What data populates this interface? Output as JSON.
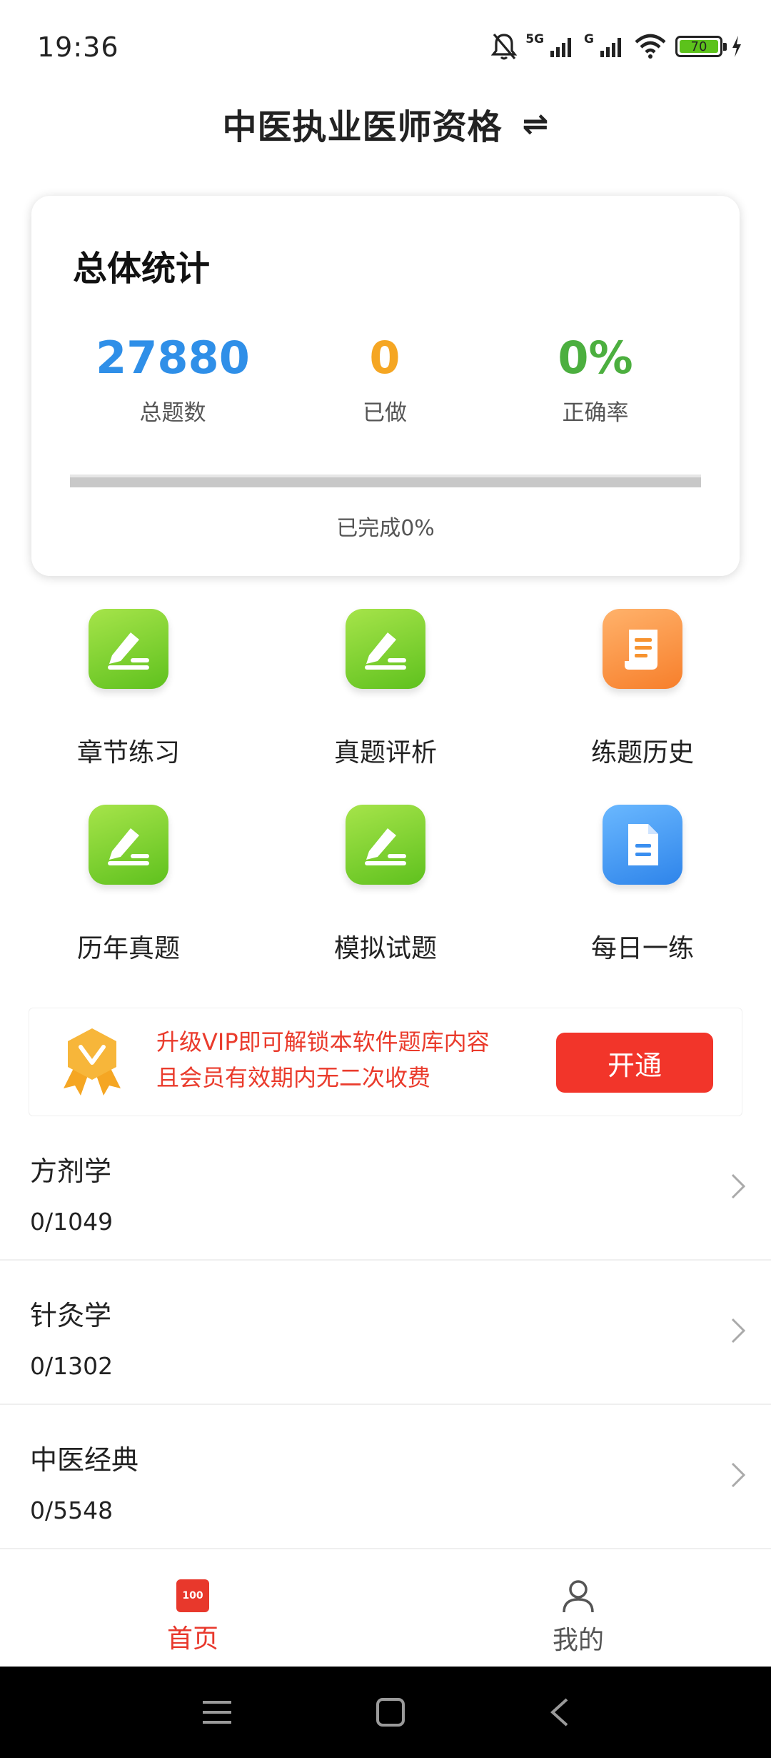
{
  "status_bar": {
    "time": "19:36",
    "network_1": "5G",
    "network_2": "G",
    "battery": "70",
    "icons": [
      "mute-bell-icon",
      "signal-icon",
      "signal-icon",
      "wifi-icon",
      "battery-icon",
      "charging-icon"
    ]
  },
  "header": {
    "title": "中医执业医师资格",
    "switch_icon": "⇌"
  },
  "stats": {
    "heading": "总体统计",
    "total": {
      "value": "27880",
      "label": "总题数",
      "color": "#2f8fe8"
    },
    "done": {
      "value": "0",
      "label": "已做",
      "color": "#f5a623"
    },
    "accuracy": {
      "value": "0%",
      "label": "正确率",
      "color": "#4caf3f"
    },
    "progress_fraction": 0,
    "progress_text": "已完成0%"
  },
  "features": [
    {
      "label": "章节练习",
      "icon": "pencil-icon",
      "color": "green"
    },
    {
      "label": "真题评析",
      "icon": "pencil-icon",
      "color": "green"
    },
    {
      "label": "练题历史",
      "icon": "scroll-icon",
      "color": "orange"
    },
    {
      "label": "历年真题",
      "icon": "pencil-icon",
      "color": "green"
    },
    {
      "label": "模拟试题",
      "icon": "pencil-icon",
      "color": "green"
    },
    {
      "label": "每日一练",
      "icon": "document-icon",
      "color": "blue"
    }
  ],
  "vip": {
    "line1": "升级VIP即可解锁本软件题库内容",
    "line2": "且会员有效期内无二次收费",
    "button": "开通",
    "badge_icon": "vip-badge-icon"
  },
  "subjects": [
    {
      "name": "方剂学",
      "progress": "0/1049"
    },
    {
      "name": "针灸学",
      "progress": "0/1302"
    },
    {
      "name": "中医经典",
      "progress": "0/5548"
    }
  ],
  "tabs": [
    {
      "label": "首页",
      "icon_text": "100",
      "active": true
    },
    {
      "label": "我的",
      "active": false
    }
  ],
  "colors": {
    "accent_red": "#e8382c",
    "green": "#5fc11e",
    "blue": "#2f8fe8",
    "orange": "#f5a623"
  }
}
